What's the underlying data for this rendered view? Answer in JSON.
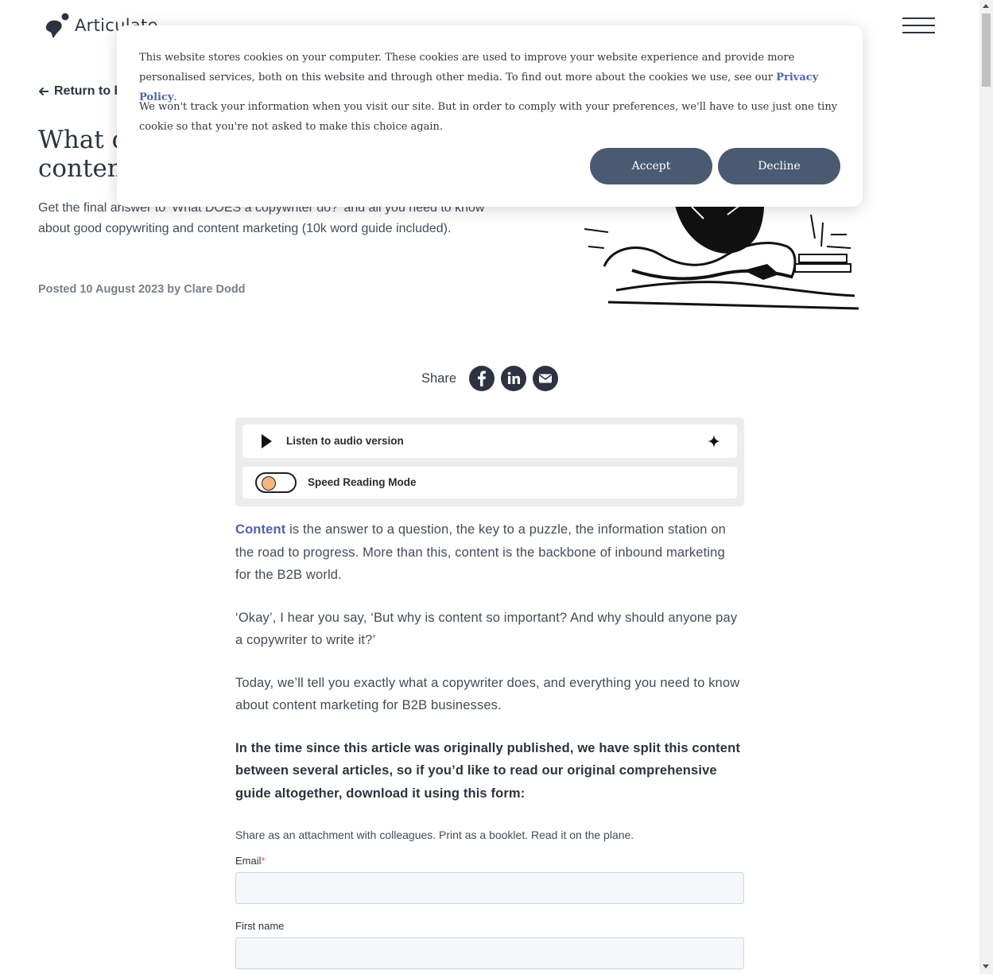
{
  "header": {
    "logo_text": "Articulate",
    "menu_icon": "hamburger-menu-icon"
  },
  "article_header": {
    "back_link": "Return to blog",
    "title": "What does a copywriter do? B2B content marketing explained",
    "subtitle": "Get the final answer to ‘What DOES a copywriter do?’ and all you need to know about good copywriting and content marketing (10k word guide included).",
    "posted": "Posted 10 August 2023 by Clare Dodd"
  },
  "share": {
    "label": "Share",
    "icons": [
      "facebook-icon",
      "linkedin-icon",
      "email-icon"
    ]
  },
  "audio": {
    "listen_label": "Listen to audio version",
    "speed_label": "Speed Reading Mode",
    "speed_mode_on": false
  },
  "article": {
    "p1_link": "Content",
    "p1_rest": " is the answer to a question, the key to a puzzle, the information station on the road to progress. More than this, content is the backbone of inbound marketing for the B2B world.",
    "p2": "‘Okay’, I hear you say, ‘But why is content so important? And why should anyone pay a copywriter to write it?’",
    "p3": "Today, we’ll tell you exactly what a copywriter does, and everything you need to know about content marketing for B2B businesses.",
    "p4": "In the time since this article was originally published, we have split this content between several articles, so if you’d like to read our original comprehensive guide altogether, download it using this form:"
  },
  "form": {
    "intro": "Share as an attachment with colleagues. Print as a booklet. Read it on the plane.",
    "email_label": "Email",
    "required_mark": "*",
    "email_value": "",
    "first_name_label": "First name",
    "first_name_value": ""
  },
  "cookie_banner": {
    "text1_before": "This website stores cookies on your computer. These cookies are used to improve your website experience and provide more personalised services, both on this website and through other media. To find out more about the cookies we use, see our ",
    "text1_link": "Privacy Policy",
    "text1_after": ".",
    "text2": "We won't track your information when you visit our site. But in order to comply with your preferences, we'll have to use just one tiny cookie so that you're not asked to make this choice again.",
    "accept_label": "Accept",
    "decline_label": "Decline"
  },
  "colors": {
    "link": "#4f64ad",
    "button": "#4a5a70",
    "text": "#454b57",
    "toggle_knob": "#f4b57e"
  }
}
